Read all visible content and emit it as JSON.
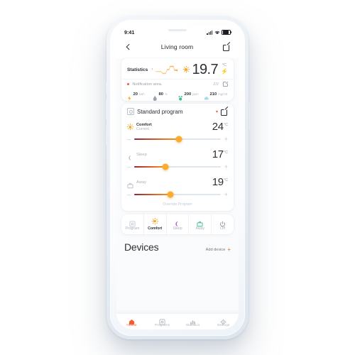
{
  "status_bar": {
    "time": "9:41",
    "signal_icon": "signal-bars-icon",
    "wifi_icon": "wifi-icon",
    "battery_icon": "battery-icon"
  },
  "header": {
    "back_icon": "chevron-left-icon",
    "title": "Living room",
    "edit_icon": "edit-pencil-icon"
  },
  "statistics_card": {
    "label": "Statistics",
    "chevron": "›",
    "sparkline_icon": "sparkline-chart",
    "sun_icon": "sun-icon",
    "temperature": "19.7",
    "temperature_unit": "°C",
    "bolt_icon": "lightning-bolt-icon",
    "notification": {
      "dot_icon": "status-dot-icon",
      "text": "Notification area.",
      "count": "2/2",
      "external_icon": "external-link-icon"
    },
    "metrics": [
      {
        "icon": "energy-bolt-icon",
        "value": "20",
        "unit": "kwh"
      },
      {
        "icon": "humidity-drop-icon",
        "value": "80",
        "unit": "%"
      },
      {
        "icon": "co2-icon",
        "value": "200",
        "unit": "ppm"
      },
      {
        "icon": "air-quality-cloud-icon",
        "value": "210",
        "unit": "mg/m3"
      }
    ]
  },
  "program_card": {
    "calendar_icon": "calendar-icon",
    "program_name": "Standard program",
    "caret_icon": "chevron-down-icon",
    "edit_icon": "edit-pencil-icon",
    "rows": [
      {
        "icon": "sun-icon",
        "title": "Comfort",
        "subtitle": "Current",
        "value": "24",
        "unit": "°C",
        "minus": "–",
        "plus": "+",
        "fill_percent": 52
      },
      {
        "icon": "moon-icon",
        "title": "Sleep",
        "subtitle": "",
        "value": "17",
        "unit": "°C",
        "minus": "–",
        "plus": "+",
        "fill_percent": 36
      },
      {
        "icon": "briefcase-icon",
        "title": "Away",
        "subtitle": "",
        "value": "19",
        "unit": "°C",
        "minus": "–",
        "plus": "+",
        "fill_percent": 42
      }
    ],
    "override_label": "Override Program"
  },
  "mode_bar": {
    "modes": [
      {
        "icon": "calendar-icon",
        "label": "Program",
        "active": false,
        "color": "#c2cad3"
      },
      {
        "icon": "sun-icon",
        "label": "Comfort",
        "active": true,
        "color": "#f7a724"
      },
      {
        "icon": "moon-icon",
        "label": "Sleep",
        "active": false,
        "color": "#a35ad6"
      },
      {
        "icon": "briefcase-icon",
        "label": "Away",
        "active": false,
        "color": "#3cc08a"
      },
      {
        "icon": "power-icon",
        "label": "Off",
        "active": false,
        "color": "#8a939d"
      }
    ]
  },
  "devices_section": {
    "title": "Devices",
    "add_label": "Add device",
    "add_plus": "+"
  },
  "tab_bar": {
    "tabs": [
      {
        "icon": "house-icon",
        "label": "House",
        "active": true
      },
      {
        "icon": "calendar-icon",
        "label": "Programs",
        "active": false
      },
      {
        "icon": "bar-chart-icon",
        "label": "Statistics",
        "active": false
      },
      {
        "icon": "gear-icon",
        "label": "Settings",
        "active": false
      }
    ]
  },
  "colors": {
    "accent": "#f25c33",
    "comfort": "#f7a724",
    "sleep": "#a35ad6",
    "away": "#3cc08a",
    "slider_thumb": "#fbab2d"
  }
}
